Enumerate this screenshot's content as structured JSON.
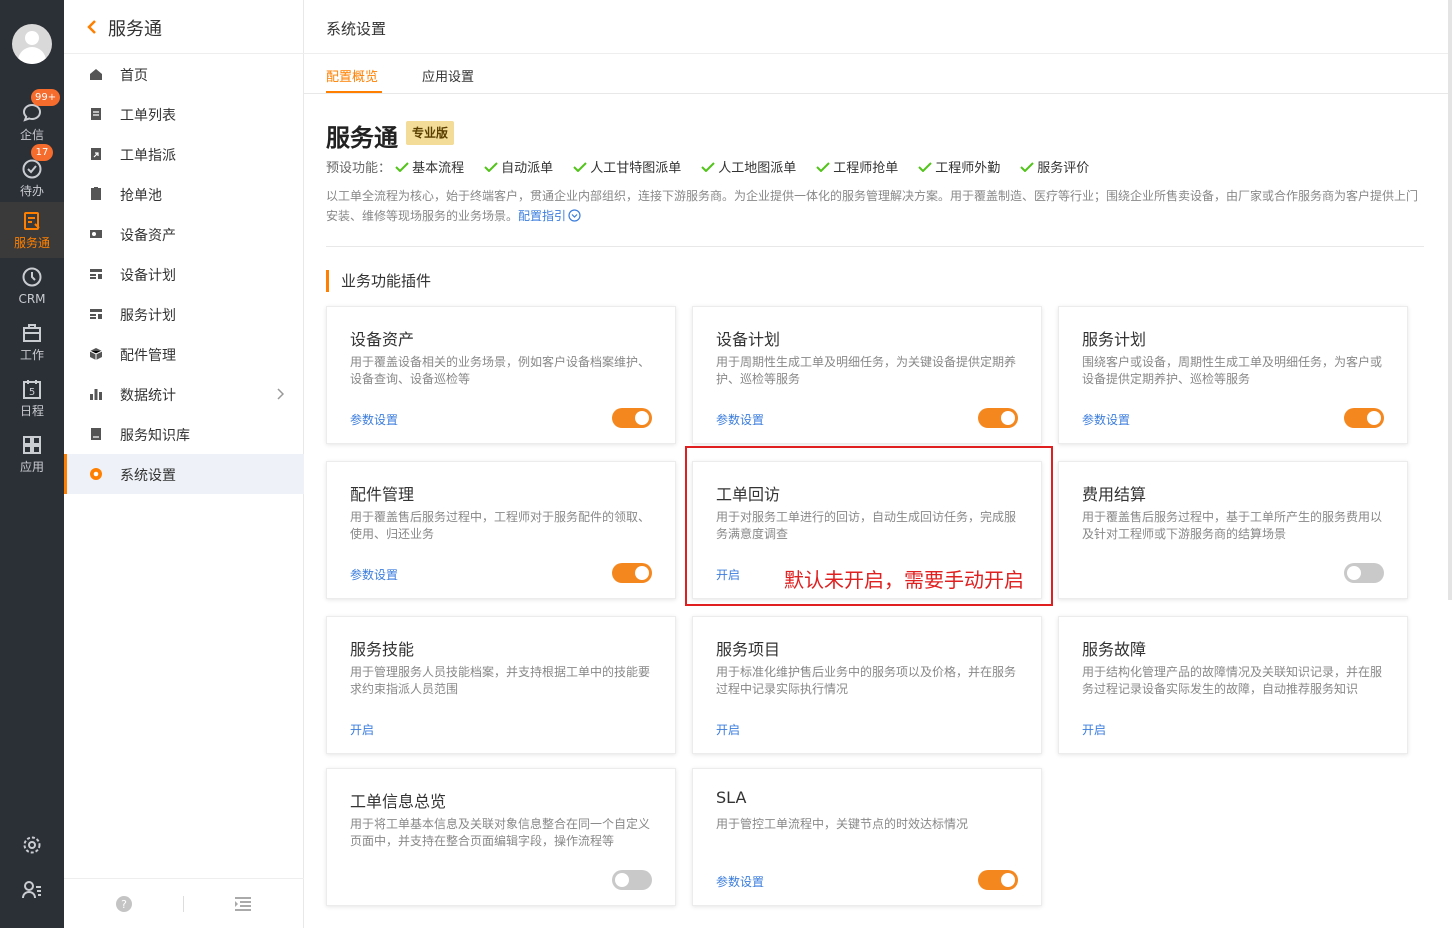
{
  "rail": {
    "items": [
      {
        "label": "企信",
        "icon": "chat-icon",
        "badge": "99+"
      },
      {
        "label": "待办",
        "icon": "todo-check-icon",
        "badge": "17"
      },
      {
        "label": "服务通",
        "icon": "service-icon"
      },
      {
        "label": "CRM",
        "icon": "crm-clock-icon"
      },
      {
        "label": "工作",
        "icon": "briefcase-icon"
      },
      {
        "label": "日程",
        "icon": "calendar-icon",
        "day": "5"
      },
      {
        "label": "应用",
        "icon": "apps-grid-icon"
      }
    ],
    "active_index": 2
  },
  "sidebar": {
    "title": "服务通",
    "items": [
      {
        "label": "首页",
        "icon": "home-icon"
      },
      {
        "label": "工单列表",
        "icon": "clipboard-icon"
      },
      {
        "label": "工单指派",
        "icon": "assign-icon"
      },
      {
        "label": "抢单池",
        "icon": "pool-icon"
      },
      {
        "label": "设备资产",
        "icon": "device-asset-icon"
      },
      {
        "label": "设备计划",
        "icon": "device-plan-icon"
      },
      {
        "label": "服务计划",
        "icon": "service-plan-icon"
      },
      {
        "label": "配件管理",
        "icon": "parts-box-icon"
      },
      {
        "label": "数据统计",
        "icon": "bar-chart-icon"
      },
      {
        "label": "服务知识库",
        "icon": "knowledge-book-icon"
      },
      {
        "label": "系统设置",
        "icon": "settings-gear-icon"
      }
    ],
    "active_index": 10
  },
  "header": {
    "title": "系统设置"
  },
  "tabs": [
    {
      "label": "配置概览",
      "active": true
    },
    {
      "label": "应用设置",
      "active": false
    }
  ],
  "app": {
    "name": "服务通",
    "edition": "专业版",
    "features_prefix": "预设功能：",
    "features": [
      "基本流程",
      "自动派单",
      "人工甘特图派单",
      "人工地图派单",
      "工程师抢单",
      "工程师外勤",
      "服务评价"
    ],
    "description": "以工单全流程为核心，始于终端客户，贯通企业内部组织，连接下游服务商。为企业提供一体化的服务管理解决方案。用于覆盖制造、医疗等行业；围绕企业所售卖设备，由厂家或合作服务商为客户提供上门安装、维修等现场服务的业务场景。",
    "guide_link": "配置指引"
  },
  "section": {
    "title": "业务功能插件"
  },
  "plugins": [
    {
      "title": "设备资产",
      "desc": "用于覆盖设备相关的业务场景，例如客户设备档案维护、设备查询、设备巡检等",
      "link": "参数设置",
      "toggle": "on"
    },
    {
      "title": "设备计划",
      "desc": "用于周期性生成工单及明细任务，为关键设备提供定期养护、巡检等服务",
      "link": "参数设置",
      "toggle": "on"
    },
    {
      "title": "服务计划",
      "desc": "围绕客户或设备，周期性生成工单及明细任务，为客户或设备提供定期养护、巡检等服务",
      "link": "参数设置",
      "toggle": "on"
    },
    {
      "title": "配件管理",
      "desc": "用于覆盖售后服务过程中，工程师对于服务配件的领取、使用、归还业务",
      "link": "参数设置",
      "toggle": "on"
    },
    {
      "title": "工单回访",
      "desc": "用于对服务工单进行的回访，自动生成回访任务，完成服务满意度调查",
      "link": "开启",
      "toggle": "none"
    },
    {
      "title": "费用结算",
      "desc": "用于覆盖售后服务过程中，基于工单所产生的服务费用以及针对工程师或下游服务商的结算场景",
      "link": "",
      "toggle": "off"
    },
    {
      "title": "服务技能",
      "desc": "用于管理服务人员技能档案，并支持根据工单中的技能要求约束指派人员范围",
      "link": "开启",
      "toggle": "none"
    },
    {
      "title": "服务项目",
      "desc": "用于标准化维护售后业务中的服务项以及价格，并在服务过程中记录实际执行情况",
      "link": "开启",
      "toggle": "none"
    },
    {
      "title": "服务故障",
      "desc": "用于结构化管理产品的故障情况及关联知识记录，并在服务过程记录设备实际发生的故障，自动推荐服务知识",
      "link": "开启",
      "toggle": "none"
    },
    {
      "title": "工单信息总览",
      "desc": "用于将工单基本信息及关联对象信息整合在同一个自定义页面中，并支持在整合页面编辑字段，操作流程等",
      "link": "",
      "toggle": "off"
    },
    {
      "title": "SLA",
      "desc": "用于管控工单流程中，关键节点的时效达标情况",
      "link": "参数设置",
      "toggle": "on"
    }
  ],
  "annotation": {
    "text": "默认未开启，需要手动开启"
  },
  "colors": {
    "accent": "#ff8000",
    "toggle_on": "#f5871f",
    "link": "#3b7ddd",
    "annotation": "#e02020"
  }
}
